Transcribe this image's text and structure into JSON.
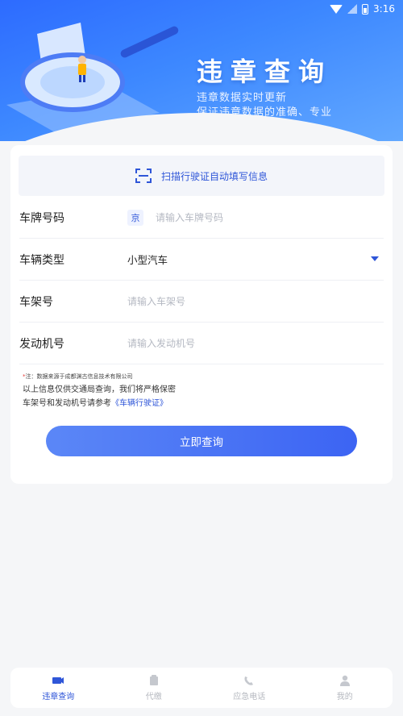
{
  "status_bar": {
    "time": "3:16"
  },
  "header": {
    "title": "违章查询",
    "subtitle_line1": "违章数据实时更新",
    "subtitle_line2": "保证违章数据的准确、专业"
  },
  "scan": {
    "label": "扫描行驶证自动填写信息"
  },
  "form": {
    "plate": {
      "label": "车牌号码",
      "prefix": "京",
      "placeholder": "请输入车牌号码"
    },
    "vehicle_type": {
      "label": "车辆类型",
      "value": "小型汽车"
    },
    "frame": {
      "label": "车架号",
      "placeholder": "请输入车架号"
    },
    "engine": {
      "label": "发动机号",
      "placeholder": "请输入发动机号"
    }
  },
  "notes": {
    "star": "*",
    "source": "注：数据来源于成都渊古信息技术有限公司",
    "privacy": "以上信息仅供交通局查询，我们将严格保密",
    "refer_prefix": "车架号和发动机号请参考",
    "refer_link": "《车辆行驶证》"
  },
  "submit_label": "立即查询",
  "nav": [
    {
      "label": "违章查询",
      "icon": "camera-icon",
      "active": true
    },
    {
      "label": "代缴",
      "icon": "wallet-icon",
      "active": false
    },
    {
      "label": "应急电话",
      "icon": "phone-icon",
      "active": false
    },
    {
      "label": "我的",
      "icon": "user-icon",
      "active": false
    }
  ],
  "colors": {
    "accent": "#2f56d8",
    "header": "#3d88ff",
    "button": "#3c64f3"
  }
}
